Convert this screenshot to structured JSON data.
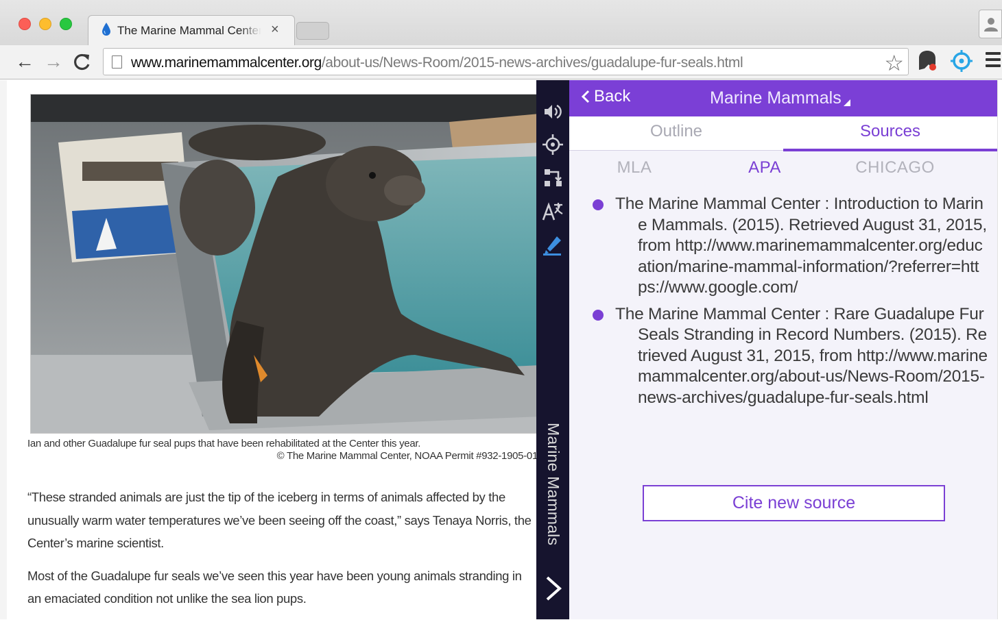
{
  "browser": {
    "tab_title": "The Marine Mammal Center",
    "tab_close": "×",
    "url_host": "www.marinemammalcenter.org",
    "url_path": "/about-us/News-Room/2015-news-archives/guadalupe-fur-seals.html",
    "nav_back": "←",
    "nav_forward": "→",
    "nav_reload": "C",
    "bookmark_star": "☆"
  },
  "article": {
    "caption_line1": "Ian and other Guadalupe fur seal pups that have been rehabilitated at the Center this year.",
    "caption_line2": "© The Marine Mammal Center, NOAA Permit #932-1905-01",
    "paragraphs": [
      "“These stranded animals are just the tip of the iceberg in terms of animals affected by the unusually warm water temperatures we’ve been seeing off the coast,” says Tenaya Norris, the Center’s marine scientist.",
      "Most of the Guadalupe fur seals we’ve seen this year have been young animals stranding in an emaciated condition not unlike the sea lion pups."
    ]
  },
  "rail": {
    "label": "Marine Mammals",
    "icons": [
      "speaker-icon",
      "crosshair-icon",
      "route-icon",
      "translate-icon",
      "highlighter-icon",
      "chevron-right-icon"
    ]
  },
  "panel": {
    "back_label": "Back",
    "title": "Marine Mammals",
    "tabs": [
      {
        "label": "Outline",
        "active": false
      },
      {
        "label": "Sources",
        "active": true
      }
    ],
    "styles": [
      {
        "label": "MLA",
        "active": false
      },
      {
        "label": "APA",
        "active": true
      },
      {
        "label": "CHICAGO",
        "active": false
      }
    ],
    "sources": [
      "The Marine Mammal Center : Introduction to Marine Mammals. (2015). Retrieved August 31, 2015, from http://www.marinemammalcenter.org/education/marine-mammal-information/?referrer=https://www.google.com/",
      "The Marine Mammal Center : Rare Guadalupe Fur Seals Stranding in Record Numbers. (2015). Retrieved August 31, 2015, from http://www.marinemammalcenter.org/about-us/News-Room/2015-news-archives/guadalupe-fur-seals.html"
    ],
    "cite_button": "Cite new source"
  },
  "colors": {
    "accent": "#7b3fd6",
    "rail_bg": "#16142e",
    "panel_bg": "#f4f3fa"
  }
}
